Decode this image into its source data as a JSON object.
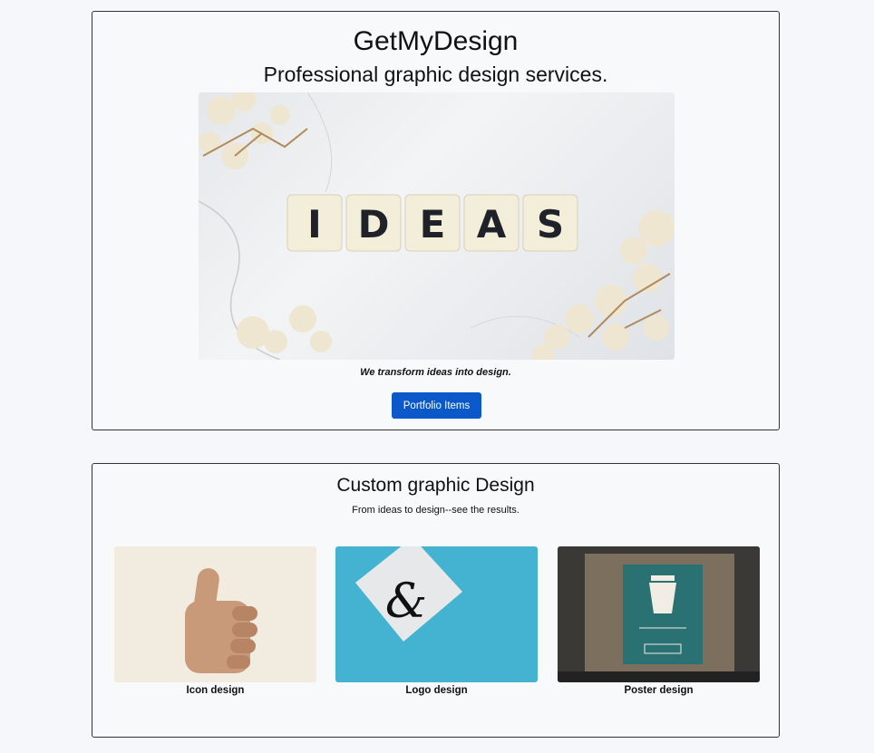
{
  "hero": {
    "title": "GetMyDesign",
    "subtitle": "Professional graphic design services.",
    "image_word": [
      "I",
      "D",
      "E",
      "A",
      "S"
    ],
    "caption": "We transform ideas into design.",
    "button_label": "Portfolio Items"
  },
  "services": {
    "title": "Custom graphic Design",
    "subtitle": "From ideas to design--see the results.",
    "items": [
      {
        "label": "Icon design"
      },
      {
        "label": "Logo design"
      },
      {
        "label": "Poster design"
      }
    ]
  },
  "colors": {
    "button": "#0a58ca",
    "page_bg": "#f5f7fa",
    "border": "#333333"
  }
}
